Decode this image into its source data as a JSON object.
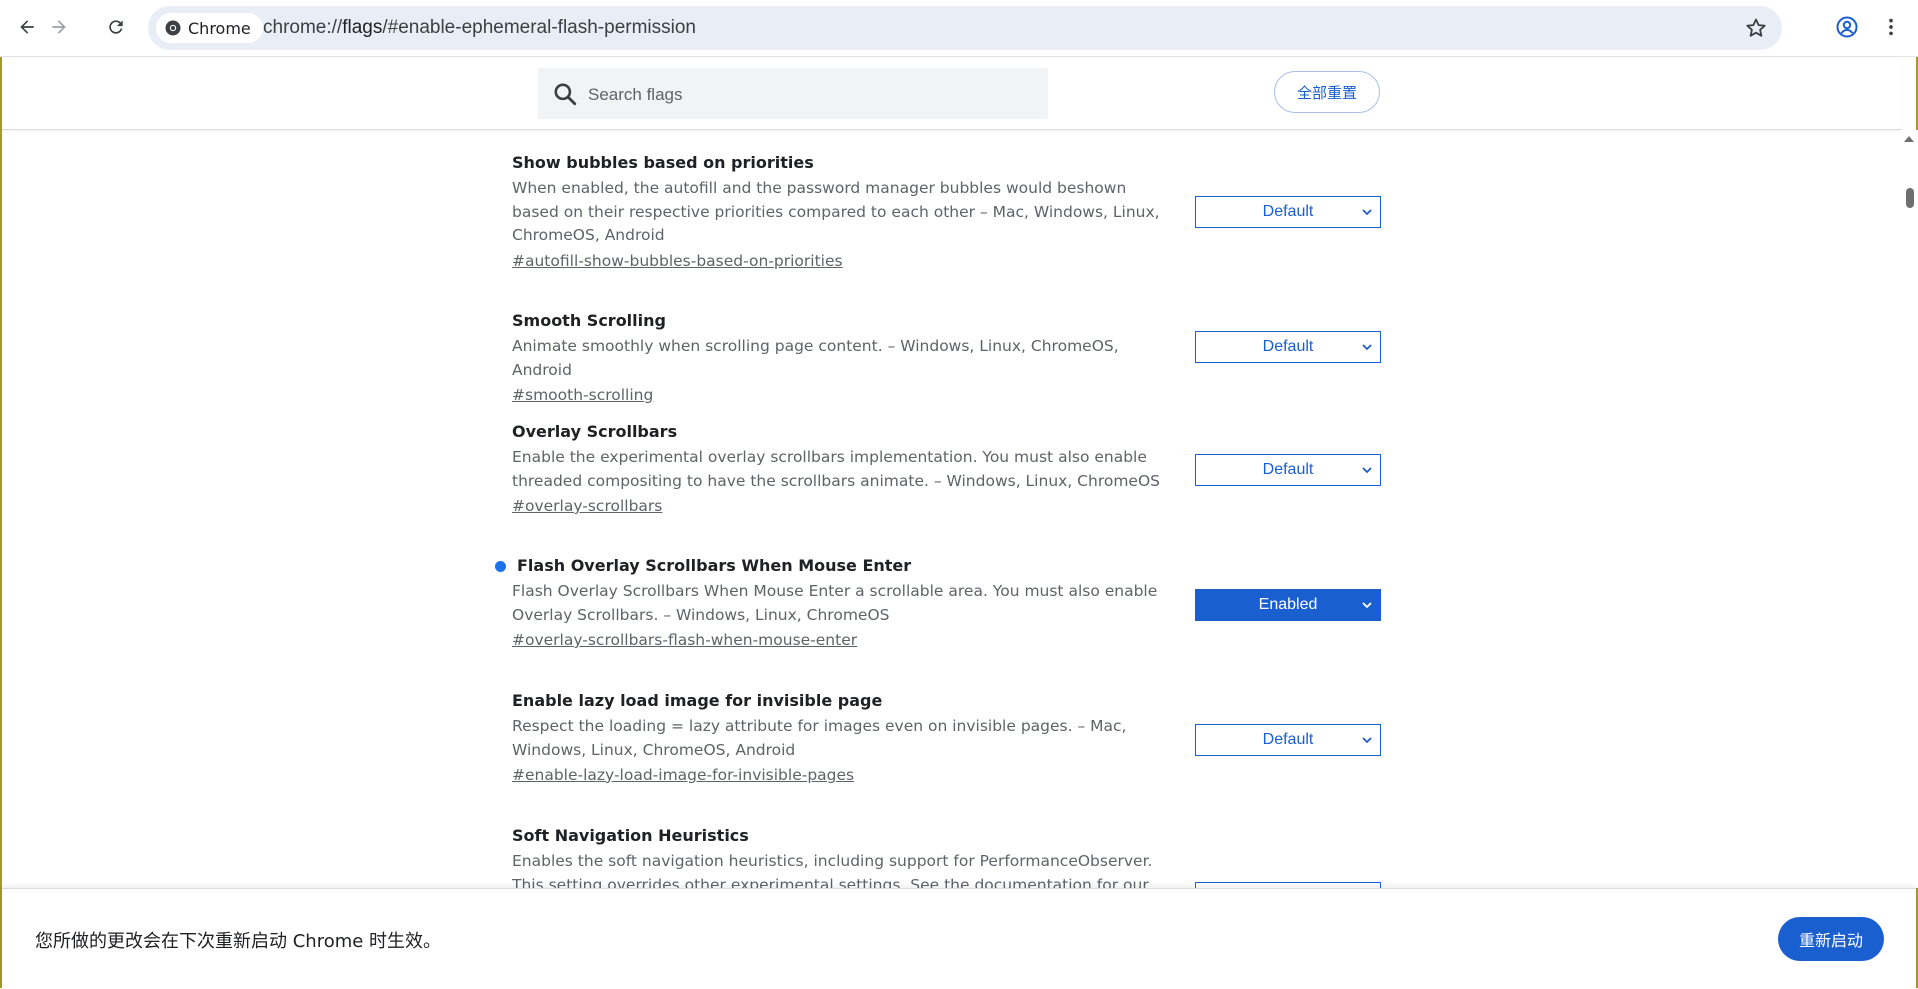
{
  "browser": {
    "chip_label": "Chrome",
    "url_scheme": "chrome://",
    "url_host": "flags",
    "url_rest": "/#enable-ephemeral-flash-permission"
  },
  "header": {
    "search_placeholder": "Search flags",
    "reset_label": "全部重置"
  },
  "flags": [
    {
      "title": "Show bubbles based on priorities",
      "description": "When enabled, the autofill and the password manager bubbles would beshown based on their respective priorities compared to each other – Mac, Windows, Linux, ChromeOS, Android",
      "link": "#autofill-show-bubbles-based-on-priorities",
      "value": "Default"
    },
    {
      "title": "Smooth Scrolling",
      "description": "Animate smoothly when scrolling page content. – Windows, Linux, ChromeOS, Android",
      "link": "#smooth-scrolling",
      "value": "Default"
    },
    {
      "title": "Overlay Scrollbars",
      "description": "Enable the experimental overlay scrollbars implementation. You must also enable threaded compositing to have the scrollbars animate. – Windows, Linux, ChromeOS",
      "link": "#overlay-scrollbars",
      "value": "Default"
    },
    {
      "title": "Flash Overlay Scrollbars When Mouse Enter",
      "description": "Flash Overlay Scrollbars When Mouse Enter a scrollable area. You must also enable Overlay Scrollbars. – Windows, Linux, ChromeOS",
      "link": "#overlay-scrollbars-flash-when-mouse-enter",
      "value": "Enabled"
    },
    {
      "title": "Enable lazy load image for invisible page",
      "description": "Respect the loading = lazy attribute for images even on invisible pages. – Mac, Windows, Linux, ChromeOS, Android",
      "link": "#enable-lazy-load-image-for-invisible-pages",
      "value": "Default"
    },
    {
      "title": "Soft Navigation Heuristics",
      "description": "Enables the soft navigation heuristics, including support for PerformanceObserver. This setting overrides other experimental settings. See the documentation for our earlier",
      "link": "",
      "value": ""
    }
  ],
  "footer": {
    "message": "您所做的更改会在下次重新启动 Chrome 时生效。",
    "relaunch_label": "重新启动"
  },
  "colors": {
    "accent": "#1a5fd0",
    "modified_dot": "#1a73e8"
  }
}
